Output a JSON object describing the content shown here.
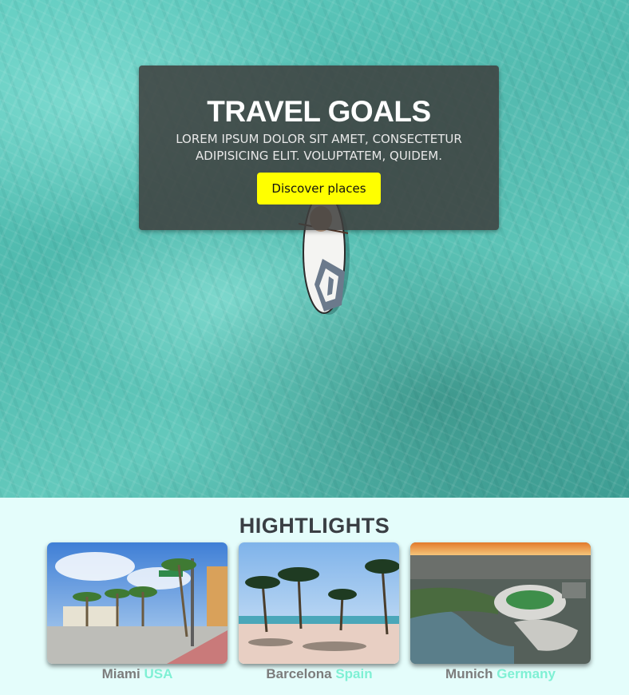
{
  "hero": {
    "title": "TRAVEL GOALS",
    "subtitle": "LOREM IPSUM DOLOR SIT AMET, CONSECTETUR ADIPISICING ELIT. VOLUPTATEM, QUIDEM.",
    "button_label": "Discover places",
    "button_color": "#ffff00"
  },
  "highlights": {
    "title": "HIGHTLIGHTS",
    "cards": [
      {
        "city": "Miami",
        "country": "USA",
        "image": "miami-street-palms-image"
      },
      {
        "city": "Barcelona",
        "country": "Spain",
        "image": "barcelona-beach-palms-image"
      },
      {
        "city": "Munich",
        "country": "Germany",
        "image": "munich-stadium-aerial-image"
      }
    ],
    "accent_color": "#7ff0d4"
  }
}
